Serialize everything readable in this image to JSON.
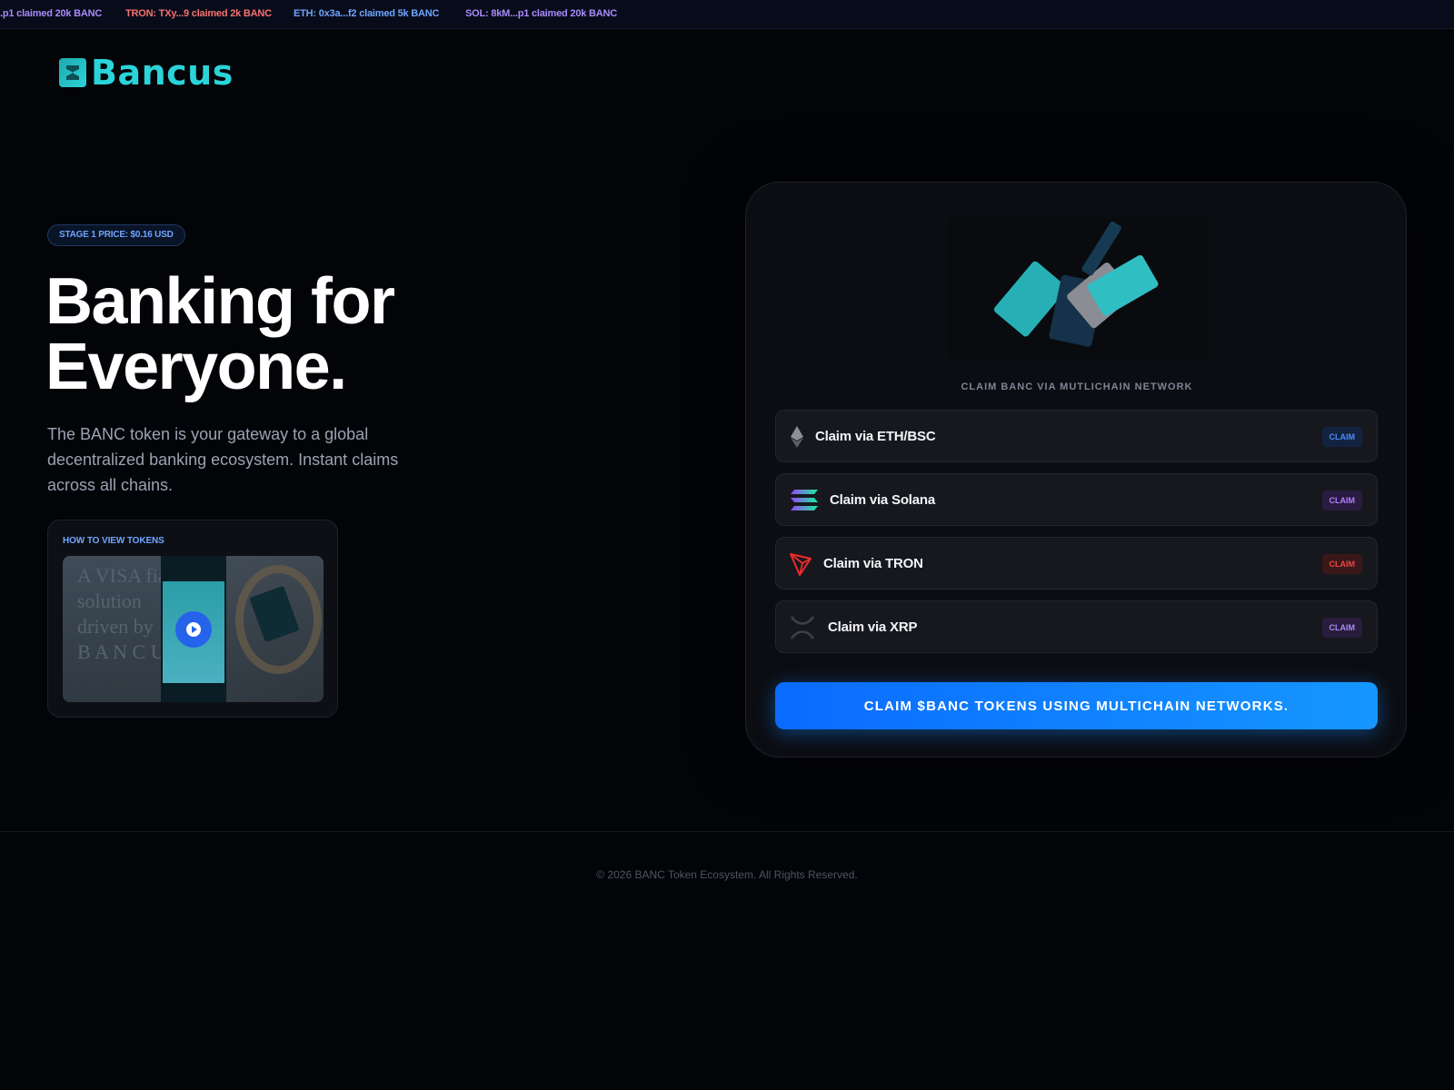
{
  "ticker": {
    "items": [
      {
        "text": ".p1 claimed 20k BANC",
        "color": "#a78bfa"
      },
      {
        "text": "TRON: TXy...9 claimed 2k BANC",
        "color": "#f87171"
      },
      {
        "text": "ETH: 0x3a...f2 claimed 5k BANC",
        "color": "#6fa5ff"
      },
      {
        "text": "SOL: 8kM...p1 claimed 20k BANC",
        "color": "#a78bfa"
      }
    ]
  },
  "brand": {
    "name": "Bancus",
    "color": "#2ad4d9"
  },
  "hero": {
    "stage_price": "STAGE 1 PRICE: $0.16 USD",
    "title_line1": "Banking for",
    "title_line2": "Everyone.",
    "description": "The BANC token is your gateway to a global decentralized banking ecosystem. Instant claims across all chains."
  },
  "video": {
    "label": "HOW TO VIEW TOKENS",
    "thumb_text": "A VISA fia\nsolution\ndriven by\nB A N C U"
  },
  "claim_panel": {
    "caption": "CLAIM BANC VIA MUTLICHAIN NETWORK",
    "rows": [
      {
        "label": "Claim via ETH/BSC",
        "badge": "CLAIM",
        "icon": "ethereum-icon",
        "badge_color": "#4b8bff",
        "badge_bg": "#13233f"
      },
      {
        "label": "Claim via Solana",
        "badge": "CLAIM",
        "icon": "solana-icon",
        "badge_color": "#b37bff",
        "badge_bg": "#2a1c40"
      },
      {
        "label": "Claim via TRON",
        "badge": "CLAIM",
        "icon": "tron-icon",
        "badge_color": "#ef4444",
        "badge_bg": "#3a1718"
      },
      {
        "label": "Claim via XRP",
        "badge": "CLAIM",
        "icon": "xrp-icon",
        "badge_color": "#a78bfa",
        "badge_bg": "#291c3c"
      }
    ],
    "button_label": "CLAIM $BANC TOKENS USING MULTICHAIN NETWORKS."
  },
  "footer": {
    "text": "© 2026 BANC Token Ecosystem. All Rights Reserved."
  }
}
